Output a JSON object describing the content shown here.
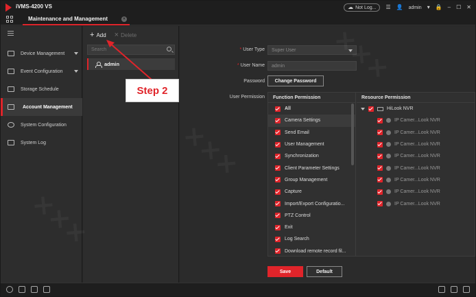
{
  "titlebar": {
    "app_title": "iVMS-4200 VS",
    "cloud_status": "Not Log...",
    "username": "admin"
  },
  "tab": {
    "label": "Maintenance and Management"
  },
  "sidebar": {
    "items": [
      {
        "label": "Device Management",
        "icon": "device-icon",
        "expandable": true
      },
      {
        "label": "Event Configuration",
        "icon": "event-icon",
        "expandable": true
      },
      {
        "label": "Storage Schedule",
        "icon": "storage-icon",
        "expandable": false
      },
      {
        "label": "Account Management",
        "icon": "account-icon",
        "expandable": false,
        "active": true
      },
      {
        "label": "System Configuration",
        "icon": "gear-icon",
        "expandable": false
      },
      {
        "label": "System Log",
        "icon": "log-icon",
        "expandable": false
      }
    ]
  },
  "users": {
    "add_label": "Add",
    "delete_label": "Delete",
    "search_placeholder": "Search",
    "list": [
      "admin"
    ]
  },
  "form": {
    "user_type_label": "User Type",
    "user_type_value": "Super User",
    "user_name_label": "User Name",
    "user_name_value": "admin",
    "password_label": "Password",
    "change_password_label": "Change Password",
    "permission_label": "User Permission"
  },
  "permissions": {
    "function_header": "Function Permission",
    "resource_header": "Resource Permission",
    "functions": [
      "All",
      "Camera Settings",
      "Send Email",
      "User Management",
      "Synchronization",
      "Client Parameter Settings",
      "Group Management",
      "Capture",
      "Import/Export Configuratio...",
      "PTZ Control",
      "Exit",
      "Log Search",
      "Download remote record fil..."
    ],
    "resource_root": "HiLook NVR",
    "resources": [
      "IP Camer...Look NVR",
      "IP Camer...Look NVR",
      "IP Camer...Look NVR",
      "IP Camer...Look NVR",
      "IP Camer...Look NVR",
      "IP Camer...Look NVR",
      "IP Camer...Look NVR",
      "IP Camer...Look NVR"
    ]
  },
  "actions": {
    "save_label": "Save",
    "default_label": "Default"
  },
  "annotation": {
    "text": "Step 2"
  },
  "colors": {
    "accent": "#e0242a",
    "background": "#2b2b2b",
    "panel": "#2d2d2d"
  }
}
